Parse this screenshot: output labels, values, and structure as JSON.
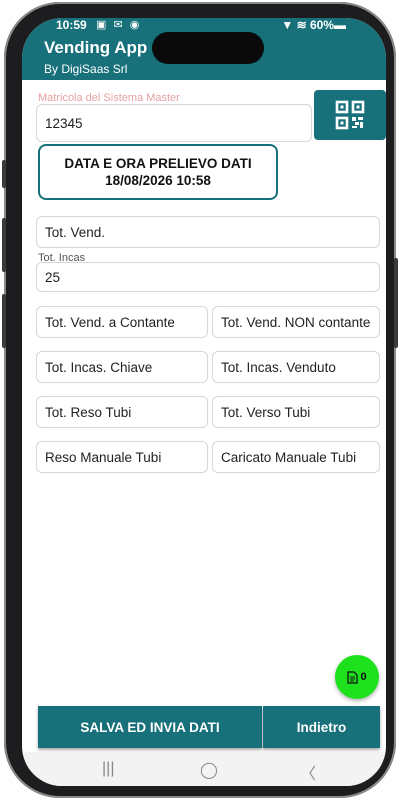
{
  "status": {
    "time": "10:59",
    "left_icons": "▣ ✉ ◉",
    "right_text": "▼ ≋ 60%▬"
  },
  "app": {
    "title": "Vending App F",
    "subtitle": "By DigiSaas Srl"
  },
  "matricola": {
    "label": "Matricola del Sistema Master",
    "value": "12345"
  },
  "datetime": {
    "line1": "DATA E ORA PRELIEVO DATI",
    "line2": "18/08/2026 10:58"
  },
  "fields": {
    "tot_vend": "Tot. Vend.",
    "tot_incas_label": "Tot. Incas",
    "tot_incas_value": "25",
    "vend_contante": "Tot. Vend. a Contante",
    "vend_non_contante": "Tot. Vend. NON contante",
    "incas_chiave": "Tot. Incas. Chiave",
    "incas_venduto": "Tot. Incas. Venduto",
    "reso_tubi": "Tot. Reso Tubi",
    "verso_tubi": "Tot. Verso Tubi",
    "reso_manuale": "Reso Manuale Tubi",
    "caricato_manuale": "Caricato Manuale Tubi"
  },
  "fab": {
    "count": "0"
  },
  "buttons": {
    "save": "SALVA ED INVIA DATI",
    "back": "Indietro"
  },
  "nav": {
    "recent": "|||",
    "home": "◯",
    "back": "〈"
  }
}
